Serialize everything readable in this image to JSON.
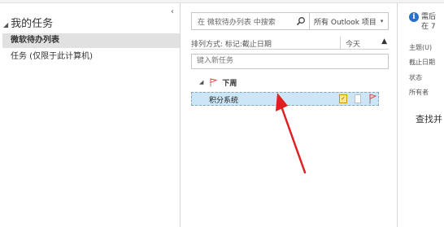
{
  "nav": {
    "title": "我的任务",
    "items": [
      {
        "label": "微软待办列表",
        "selected": true
      },
      {
        "label": "任务 (仅限于此计算机)",
        "selected": false
      }
    ]
  },
  "list": {
    "search_placeholder": "在 微软待办列表 中搜索",
    "scope": "所有 Outlook 项目",
    "sort_label": "排列方式: 标记:截止日期",
    "sort_order": "今天",
    "new_task_placeholder": "键入新任务",
    "group_label": "下周",
    "tasks": [
      {
        "subject": "积分系统"
      }
    ]
  },
  "reading": {
    "info_line1": "需后",
    "info_line2": "在 7",
    "fields": {
      "subject": "主题(U)",
      "due": "截止日期",
      "status": "状态",
      "owner": "所有者"
    },
    "find": "查找并"
  },
  "colors": {
    "selection": "#cde6f7",
    "annotation_arrow": "#e02020",
    "info_icon": "#2b6fc6",
    "flag": "#d93a3a"
  }
}
